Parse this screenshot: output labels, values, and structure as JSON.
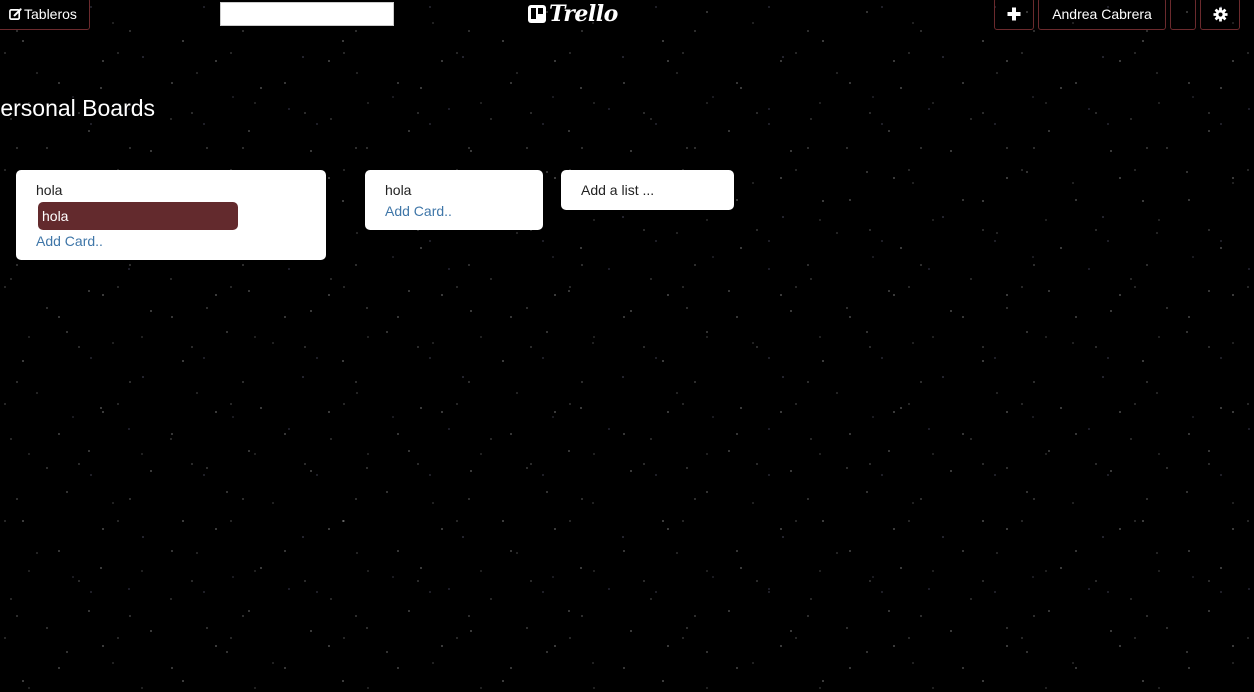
{
  "header": {
    "boards_label": "Tableros",
    "search": {
      "value": "",
      "placeholder": ""
    },
    "logo_text": "Trello",
    "add_label": "✚",
    "user_name": "Andrea Cabrera",
    "settings_glyph": "⚙"
  },
  "page": {
    "title": "Personal Boards"
  },
  "lists": [
    {
      "title": "hola",
      "cards": [
        "hola"
      ],
      "add_card_label": "Add Card.."
    },
    {
      "title": "hola",
      "cards": [],
      "add_card_label": "Add Card.."
    }
  ],
  "add_list_label": "Add a list ...",
  "colors": {
    "background": "#000000",
    "card": "#632a2d",
    "button_border": "#6b2a2d",
    "link": "#3f76a8"
  },
  "icons": {
    "boards": "edit-square-icon",
    "add": "plus-icon",
    "settings": "gear-icon",
    "logo": "trello-logo-icon"
  }
}
